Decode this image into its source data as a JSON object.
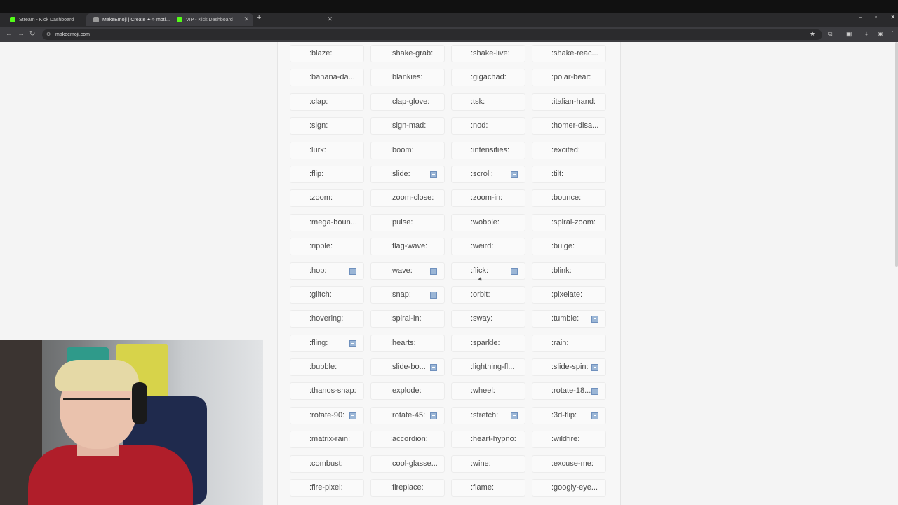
{
  "browser": {
    "tabs": [
      {
        "title": "Stream - Kick Dashboard",
        "favicon_color": "#53fc18",
        "active": false
      },
      {
        "title": "MakeEmoji | Create ✦✧ moti...",
        "favicon_color": "#9a9a9a",
        "active": true
      },
      {
        "title": "VIP - Kick Dashboard",
        "favicon_color": "#53fc18",
        "active": false
      }
    ],
    "new_tab_icon": "+",
    "url": "makeemoji.com"
  },
  "emotes": [
    {
      "label": ":blaze:",
      "badge": false
    },
    {
      "label": ":shake-grab:",
      "badge": false
    },
    {
      "label": ":shake-live:",
      "badge": false
    },
    {
      "label": ":shake-reac...",
      "badge": false
    },
    {
      "label": ":banana-da...",
      "badge": false
    },
    {
      "label": ":blankies:",
      "badge": false
    },
    {
      "label": ":gigachad:",
      "badge": false
    },
    {
      "label": ":polar-bear:",
      "badge": false
    },
    {
      "label": ":clap:",
      "badge": false
    },
    {
      "label": ":clap-glove:",
      "badge": false
    },
    {
      "label": ":tsk:",
      "badge": false
    },
    {
      "label": ":italian-hand:",
      "badge": false
    },
    {
      "label": ":sign:",
      "badge": false
    },
    {
      "label": ":sign-mad:",
      "badge": false
    },
    {
      "label": ":nod:",
      "badge": false
    },
    {
      "label": ":homer-disa...",
      "badge": false
    },
    {
      "label": ":lurk:",
      "badge": false
    },
    {
      "label": ":boom:",
      "badge": false
    },
    {
      "label": ":intensifies:",
      "badge": false
    },
    {
      "label": ":excited:",
      "badge": false
    },
    {
      "label": ":flip:",
      "badge": false
    },
    {
      "label": ":slide:",
      "badge": true
    },
    {
      "label": ":scroll:",
      "badge": true
    },
    {
      "label": ":tilt:",
      "badge": false
    },
    {
      "label": ":zoom:",
      "badge": false
    },
    {
      "label": ":zoom-close:",
      "badge": false
    },
    {
      "label": ":zoom-in:",
      "badge": false
    },
    {
      "label": ":bounce:",
      "badge": false
    },
    {
      "label": ":mega-boun...",
      "badge": false
    },
    {
      "label": ":pulse:",
      "badge": false
    },
    {
      "label": ":wobble:",
      "badge": false
    },
    {
      "label": ":spiral-zoom:",
      "badge": false
    },
    {
      "label": ":ripple:",
      "badge": false
    },
    {
      "label": ":flag-wave:",
      "badge": false
    },
    {
      "label": ":weird:",
      "badge": false
    },
    {
      "label": ":bulge:",
      "badge": false
    },
    {
      "label": ":hop:",
      "badge": true
    },
    {
      "label": ":wave:",
      "badge": true
    },
    {
      "label": ":flick:",
      "badge": true
    },
    {
      "label": ":blink:",
      "badge": false
    },
    {
      "label": ":glitch:",
      "badge": false
    },
    {
      "label": ":snap:",
      "badge": true
    },
    {
      "label": ":orbit:",
      "badge": false
    },
    {
      "label": ":pixelate:",
      "badge": false
    },
    {
      "label": ":hovering:",
      "badge": false
    },
    {
      "label": ":spiral-in:",
      "badge": false
    },
    {
      "label": ":sway:",
      "badge": false
    },
    {
      "label": ":tumble:",
      "badge": true
    },
    {
      "label": ":fling:",
      "badge": true
    },
    {
      "label": ":hearts:",
      "badge": false
    },
    {
      "label": ":sparkle:",
      "badge": false
    },
    {
      "label": ":rain:",
      "badge": false
    },
    {
      "label": ":bubble:",
      "badge": false
    },
    {
      "label": ":slide-bo...",
      "badge": true
    },
    {
      "label": ":lightning-fl...",
      "badge": false
    },
    {
      "label": ":slide-spin:",
      "badge": true
    },
    {
      "label": ":thanos-snap:",
      "badge": false
    },
    {
      "label": ":explode:",
      "badge": false
    },
    {
      "label": ":wheel:",
      "badge": false
    },
    {
      "label": ":rotate-18...",
      "badge": true
    },
    {
      "label": ":rotate-90:",
      "badge": true
    },
    {
      "label": ":rotate-45:",
      "badge": true
    },
    {
      "label": ":stretch:",
      "badge": true
    },
    {
      "label": ":3d-flip:",
      "badge": true
    },
    {
      "label": ":matrix-rain:",
      "badge": false
    },
    {
      "label": ":accordion:",
      "badge": false
    },
    {
      "label": ":heart-hypno:",
      "badge": false
    },
    {
      "label": ":wildfire:",
      "badge": false
    },
    {
      "label": ":combust:",
      "badge": false
    },
    {
      "label": ":cool-glasse...",
      "badge": false
    },
    {
      "label": ":wine:",
      "badge": false
    },
    {
      "label": ":excuse-me:",
      "badge": false
    },
    {
      "label": ":fire-pixel:",
      "badge": false
    },
    {
      "label": ":fireplace:",
      "badge": false
    },
    {
      "label": ":flame:",
      "badge": false
    },
    {
      "label": ":googly-eye...",
      "badge": false
    }
  ]
}
